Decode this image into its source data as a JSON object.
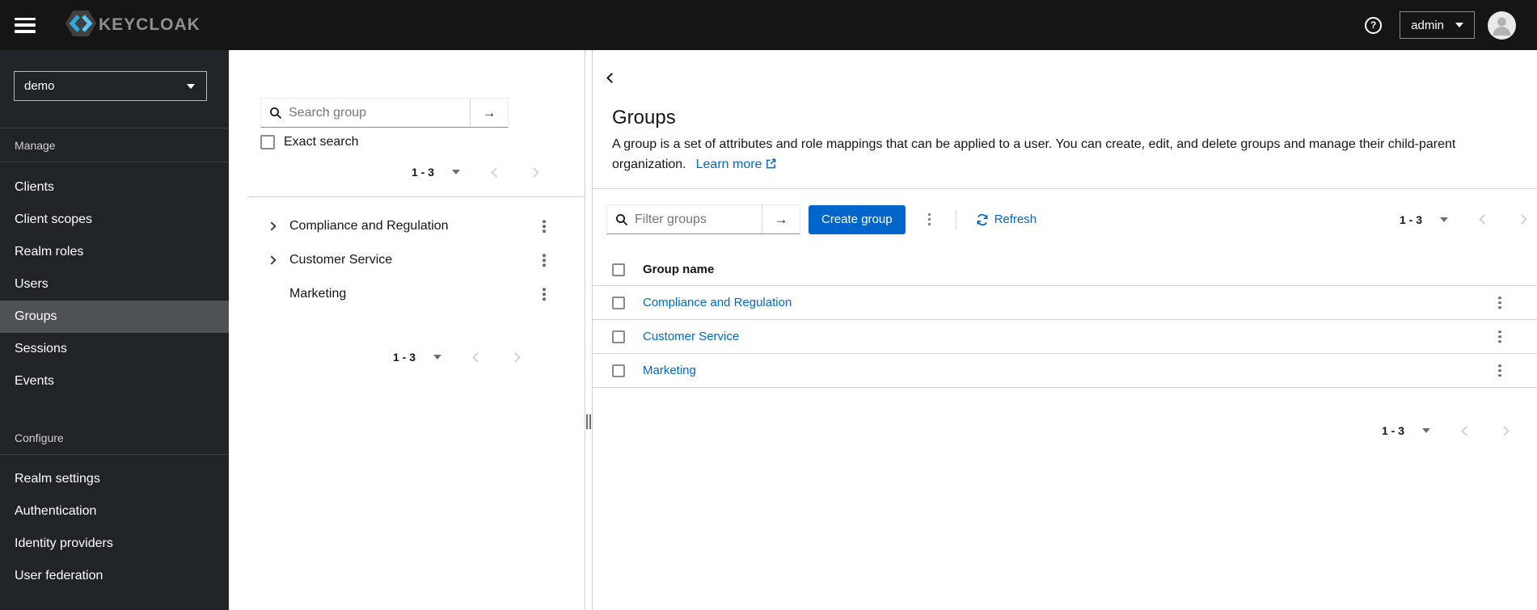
{
  "masthead": {
    "brand": "KEYCLOAK",
    "user": "admin"
  },
  "icons": {
    "help_glyph": "?",
    "arrow_right": "→"
  },
  "colors": {
    "primary": "#0066cc",
    "link": "#0066cc",
    "masthead_bg": "#151515",
    "sidebar_bg": "#212427",
    "sidebar_selected": "#4f5255"
  },
  "sidebar": {
    "realm": "demo",
    "selected": "Groups",
    "manage": {
      "label": "Manage",
      "items": [
        "Clients",
        "Client scopes",
        "Realm roles",
        "Users",
        "Groups",
        "Sessions",
        "Events"
      ]
    },
    "configure": {
      "label": "Configure",
      "items": [
        "Realm settings",
        "Authentication",
        "Identity providers",
        "User federation"
      ]
    }
  },
  "tree": {
    "search_placeholder": "Search group",
    "exact_search": "Exact search",
    "pagination_range": "1 - 3",
    "groups": [
      {
        "name": "Compliance and Regulation",
        "expandable": true
      },
      {
        "name": "Customer Service",
        "expandable": true
      },
      {
        "name": "Marketing",
        "expandable": false
      }
    ]
  },
  "main": {
    "title": "Groups",
    "description": "A group is a set of attributes and role mappings that can be applied to a user. You can create, edit, and delete groups and manage their child-parent organization.",
    "learn_more": "Learn more",
    "toolbar": {
      "filter_placeholder": "Filter groups",
      "create": "Create group",
      "refresh": "Refresh",
      "pagination_range": "1 - 3"
    },
    "table": {
      "header": "Group name",
      "rows": [
        {
          "name": "Compliance and Regulation"
        },
        {
          "name": "Customer Service"
        },
        {
          "name": "Marketing"
        }
      ]
    },
    "pagination_range": "1 - 3"
  }
}
